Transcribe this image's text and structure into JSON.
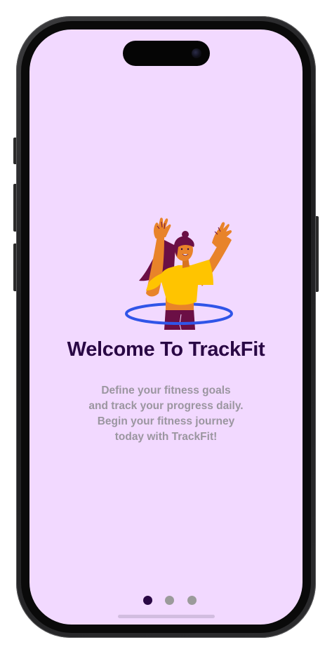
{
  "onboarding": {
    "title": "Welcome To TrackFit",
    "description_lines": [
      "Define your fitness goals",
      "and track your progress daily.",
      "Begin your fitness journey",
      "today with TrackFit!"
    ],
    "illustration": "woman-hula-hoop-illustration",
    "pager": {
      "total_pages": 3,
      "active_page": 1
    }
  },
  "colors": {
    "background": "#f2d9ff",
    "title": "#2a0845",
    "description": "#9b96a0",
    "dot_active": "#2a0845",
    "dot_inactive": "#9b9b9b",
    "hoop": "#3055e8",
    "shirt": "#ffc400",
    "skin": "#e8832a",
    "hair_pants": "#6b0f45"
  }
}
